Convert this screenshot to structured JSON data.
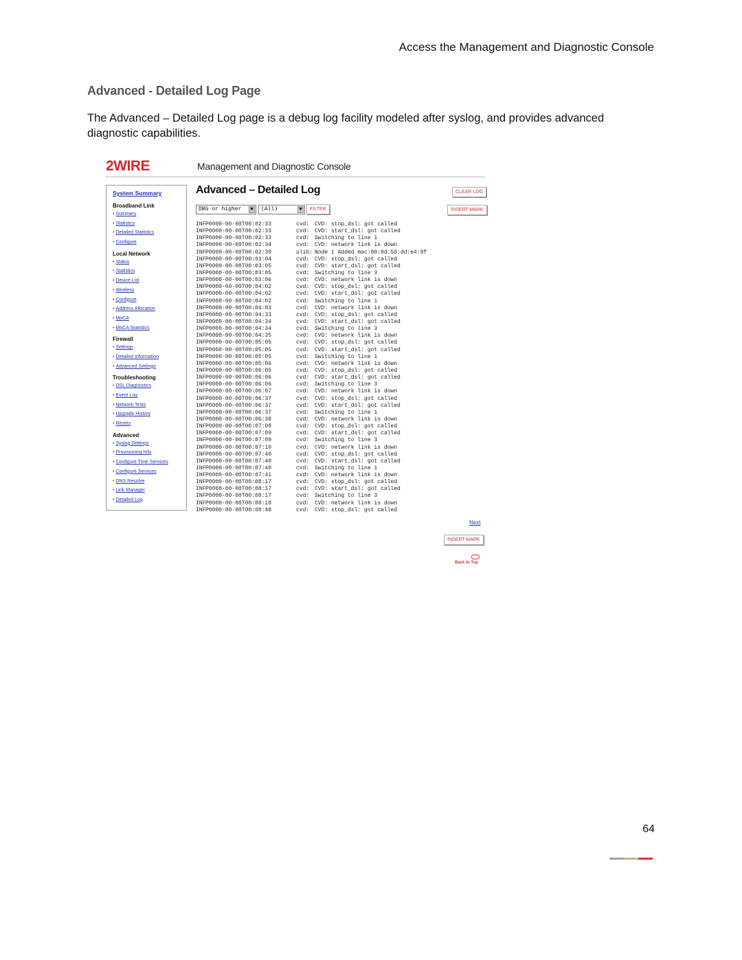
{
  "doc": {
    "header": "Access the Management and Diagnostic Console",
    "section_title": "Advanced - Detailed Log Page",
    "intro": "The Advanced – Detailed Log page is a debug log facility modeled after syslog, and provides advanced diagnostic capabilities.",
    "page_number": "64",
    "footer_colors": [
      "#a0a0a0",
      "#c8b48c",
      "#e0342c"
    ]
  },
  "console": {
    "brand": "2WIRE",
    "title": "Management and Diagnostic Console",
    "page_title": "Advanced – Detailed Log",
    "buttons": {
      "clear_log": "CLEAR LOG",
      "insert_mark": "INSERT MARK",
      "filter": "FILTER",
      "insert_mark_bottom": "INSERT MARK"
    },
    "filters": {
      "level": "DBG or higher",
      "source": "(All)"
    },
    "next": "Next",
    "back_to_top": "Back to Top",
    "sidebar": {
      "system_summary": "System Summary",
      "groups": [
        {
          "title": "Broadband Link",
          "items": [
            "Summary",
            "Statistics",
            "Detailed Statistics",
            "Configure"
          ]
        },
        {
          "title": "Local Network",
          "items": [
            "Status",
            "Statistics",
            "Device List",
            "Wireless",
            "Configure",
            "Address Allocation",
            "MoCA",
            "MoCA Statistics"
          ]
        },
        {
          "title": "Firewall",
          "items": [
            "Settings",
            "Detailed Information",
            "Advanced Settings"
          ]
        },
        {
          "title": "Troubleshooting",
          "items": [
            "DSL Diagnostics",
            "Event Log",
            "Network Tests",
            "Upgrade History",
            "Resets"
          ]
        },
        {
          "title": "Advanced",
          "items": [
            "Syslog Settings",
            "Provisioning Info",
            "Configure Time Services",
            "Configure Services",
            "DNS Resolve",
            "Link Manager",
            "Detailed Log"
          ]
        }
      ]
    },
    "log": [
      [
        "INF",
        "P0000-00-00T00:02:33",
        "cvd:",
        "CVD: stop_dsl: got called"
      ],
      [
        "INF",
        "P0000-00-00T00:02:33",
        "cvd:",
        "CVD: start_dsl: got called"
      ],
      [
        "INF",
        "P0000-00-00T00:02:33",
        "cvd:",
        "Switching to line 1"
      ],
      [
        "INF",
        "P0000-00-00T00:02:34",
        "cvd:",
        "CVD: network link is down"
      ],
      [
        "INF",
        "P0000-00-00T00:02:39",
        "ulib:",
        "Node 1 Added mac:00:0d:56:dd:e4:9f"
      ],
      [
        "INF",
        "P0000-00-00T00:03:04",
        "cvd:",
        "CVD: stop_dsl: got called"
      ],
      [
        "INF",
        "P0000-00-00T00:03:05",
        "cvd:",
        "CVD: start_dsl: got called"
      ],
      [
        "INF",
        "P0000-00-00T00:03:05",
        "cvd:",
        "Switching to line 3"
      ],
      [
        "INF",
        "P0000-00-00T00:03:06",
        "cvd:",
        "CVD: network link is down"
      ],
      [
        "INF",
        "P0000-00-00T00:04:02",
        "cvd:",
        "CVD: stop_dsl: got called"
      ],
      [
        "INF",
        "P0000-00-00T00:04:02",
        "cvd:",
        "CVD: start_dsl: got called"
      ],
      [
        "INF",
        "P0000-00-00T00:04:02",
        "cvd:",
        "Switching to line 1"
      ],
      [
        "INF",
        "P0000-00-00T00:04:03",
        "cvd:",
        "CVD: network link is down"
      ],
      [
        "INF",
        "P0000-00-00T00:04:33",
        "cvd:",
        "CVD: stop_dsl: got called"
      ],
      [
        "INF",
        "P0000-00-00T00:04:34",
        "cvd:",
        "CVD: start_dsl: got called"
      ],
      [
        "INF",
        "P0000-00-00T00:04:34",
        "cvd:",
        "Switching to line 3"
      ],
      [
        "INF",
        "P0000-00-00T00:04:35",
        "cvd:",
        "CVD: network link is down"
      ],
      [
        "INF",
        "P0000-00-00T00:05:05",
        "cvd:",
        "CVD: stop_dsl: got called"
      ],
      [
        "INF",
        "P0000-00-00T00:05:05",
        "cvd:",
        "CVD: start_dsl: got called"
      ],
      [
        "INF",
        "P0000-00-00T00:05:05",
        "cvd:",
        "Switching to line 1"
      ],
      [
        "INF",
        "P0000-00-00T00:05:06",
        "cvd:",
        "CVD: network link is down"
      ],
      [
        "INF",
        "P0000-00-00T00:06:05",
        "cvd:",
        "CVD: stop_dsl: got called"
      ],
      [
        "INF",
        "P0000-00-00T00:06:06",
        "cvd:",
        "CVD: start_dsl: got called"
      ],
      [
        "INF",
        "P0000-00-00T00:06:06",
        "cvd:",
        "Switching to line 3"
      ],
      [
        "INF",
        "P0000-00-00T00:06:07",
        "cvd:",
        "CVD: network link is down"
      ],
      [
        "INF",
        "P0000-00-00T00:06:37",
        "cvd:",
        "CVD: stop_dsl: got called"
      ],
      [
        "INF",
        "P0000-00-00T00:06:37",
        "cvd:",
        "CVD: start_dsl: got called"
      ],
      [
        "INF",
        "P0000-00-00T00:06:37",
        "cvd:",
        "Switching to line 1"
      ],
      [
        "INF",
        "P0000-00-00T00:06:38",
        "cvd:",
        "CVD: network link is down"
      ],
      [
        "INF",
        "P0000-00-00T00:07:08",
        "cvd:",
        "CVD: stop_dsl: got called"
      ],
      [
        "INF",
        "P0000-00-00T00:07:09",
        "cvd:",
        "CVD: start_dsl: got called"
      ],
      [
        "INF",
        "P0000-00-00T00:07:09",
        "cvd:",
        "Switching to line 3"
      ],
      [
        "INF",
        "P0000-00-00T00:07:10",
        "cvd:",
        "CVD: network link is down"
      ],
      [
        "INF",
        "P0000-00-00T00:07:40",
        "cvd:",
        "CVD: stop_dsl: got called"
      ],
      [
        "INF",
        "P0000-00-00T00:07:40",
        "cvd:",
        "CVD: start_dsl: got called"
      ],
      [
        "INF",
        "P0000-00-00T00:07:40",
        "cvd:",
        "Switching to line 1"
      ],
      [
        "INF",
        "P0000-00-00T00:07:41",
        "cvd:",
        "CVD: network link is down"
      ],
      [
        "INF",
        "P0000-00-00T00:08:17",
        "cvd:",
        "CVD: stop_dsl: got called"
      ],
      [
        "INF",
        "P0000-00-00T00:08:17",
        "cvd:",
        "CVD: start_dsl: got called"
      ],
      [
        "INF",
        "P0000-00-00T00:08:17",
        "cvd:",
        "Switching to line 3"
      ],
      [
        "INF",
        "P0000-00-00T00:08:18",
        "cvd:",
        "CVD: network link is down"
      ],
      [
        "INF",
        "P0000-00-00T00:08:48",
        "cvd:",
        "CVD: stop_dsl: got called"
      ]
    ]
  }
}
